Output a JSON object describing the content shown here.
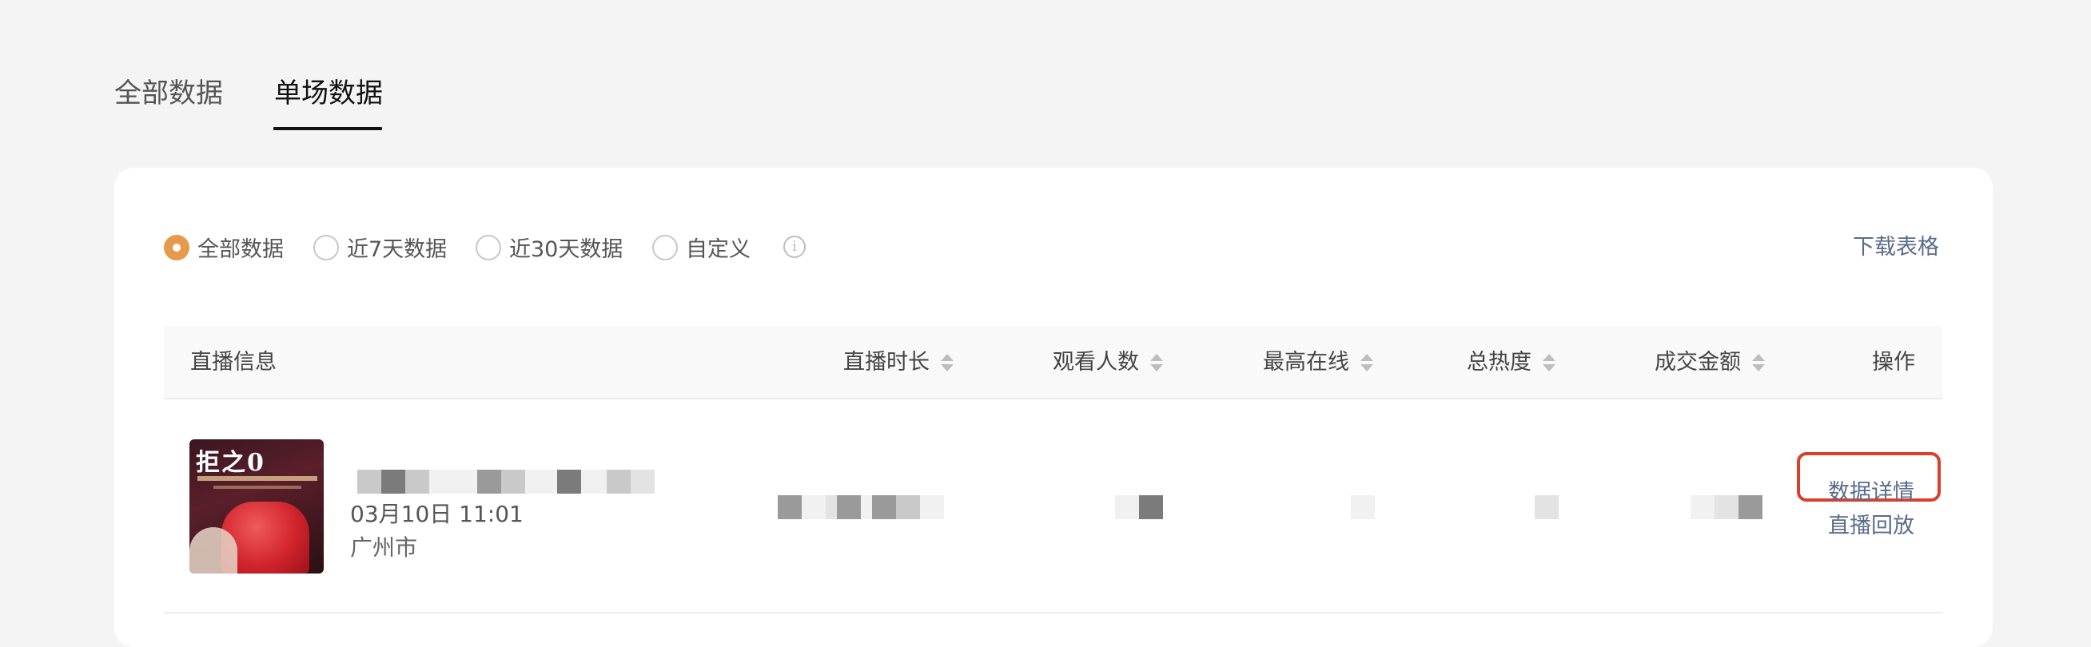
{
  "tabs": [
    {
      "label": "全部数据",
      "active": false
    },
    {
      "label": "单场数据",
      "active": true
    }
  ],
  "filters": {
    "options": [
      {
        "label": "全部数据",
        "checked": true
      },
      {
        "label": "近7天数据",
        "checked": false
      },
      {
        "label": "近30天数据",
        "checked": false
      },
      {
        "label": "自定义",
        "checked": false
      }
    ],
    "info_icon": "info-icon",
    "download_label": "下载表格"
  },
  "table": {
    "columns": [
      "直播信息",
      "直播时长",
      "观看人数",
      "最高在线",
      "总热度",
      "成交金额",
      "操作"
    ],
    "rows": [
      {
        "date": "03月10日 11:01",
        "city": "广州市",
        "thumbnail_text": "拒之0",
        "actions": [
          "数据详情",
          "直播回放"
        ]
      }
    ]
  },
  "colors": {
    "accent": "#e69a4b",
    "link": "#5b6b8a",
    "highlight_box": "#d9402c"
  }
}
